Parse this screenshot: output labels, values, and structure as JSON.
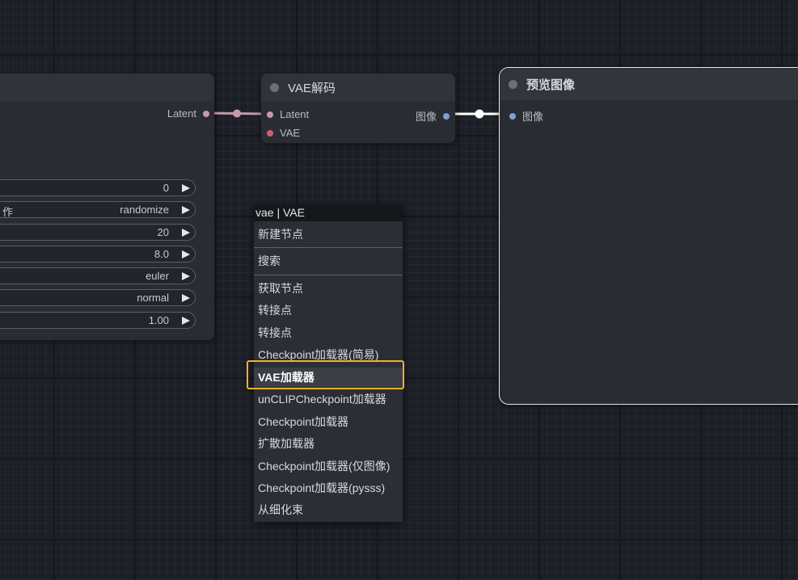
{
  "left_node": {
    "output_label": "Latent",
    "widgets": [
      {
        "label": "",
        "value": "0"
      },
      {
        "label": "作",
        "value": "randomize"
      },
      {
        "label": "",
        "value": "20"
      },
      {
        "label": "",
        "value": "8.0"
      },
      {
        "label": "",
        "value": "euler"
      },
      {
        "label": "",
        "value": "normal"
      },
      {
        "label": "",
        "value": "1.00"
      }
    ]
  },
  "vae_decode_node": {
    "title": "VAE解码",
    "inputs": [
      "Latent",
      "VAE"
    ],
    "output": "图像"
  },
  "preview_node": {
    "title": "预览图像",
    "input": "图像"
  },
  "search_menu": {
    "title": "vae | VAE",
    "items": [
      "新建节点",
      "搜索",
      "获取节点",
      "转接点",
      "转接点",
      "Checkpoint加载器(简易)",
      "VAE加载器",
      "unCLIPCheckpoint加载器",
      "Checkpoint加载器",
      "扩散加载器",
      "Checkpoint加载器(仅图像)",
      "Checkpoint加载器(pysss)",
      "从细化束"
    ],
    "selected": "VAE加载器"
  },
  "colors": {
    "latent_link": "#c49aa8",
    "image_link": "#ffffff",
    "vae_slot": "#d1606b",
    "image_slot": "#7d9fd6",
    "highlight": "#f0b323"
  }
}
